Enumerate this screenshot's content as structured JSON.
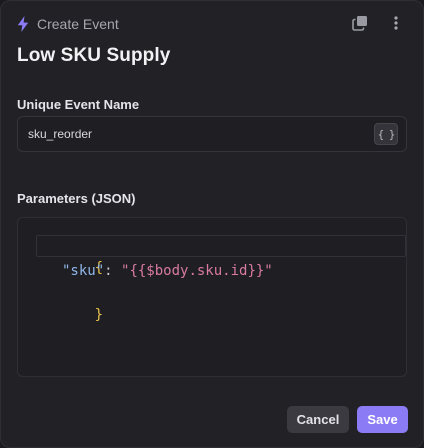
{
  "header": {
    "title": "Create Event",
    "icons": {
      "leading": "bolt-icon",
      "copy": "copy-icon",
      "more": "more-vertical-icon"
    }
  },
  "page": {
    "title": "Low SKU Supply"
  },
  "event_name": {
    "label": "Unique Event Name",
    "value": "sku_reorder",
    "braces_button": "{ }"
  },
  "parameters": {
    "label": "Parameters (JSON)",
    "code": {
      "open_brace": "{",
      "key": "\"sku\"",
      "colon": ": ",
      "value": "\"{{$body.sku.id}}\"",
      "close_brace": "}"
    }
  },
  "footer": {
    "cancel_label": "Cancel",
    "save_label": "Save"
  },
  "colors": {
    "accent": "#8b7cf6",
    "bolt": "#8b7cf6",
    "background": "#222226"
  }
}
